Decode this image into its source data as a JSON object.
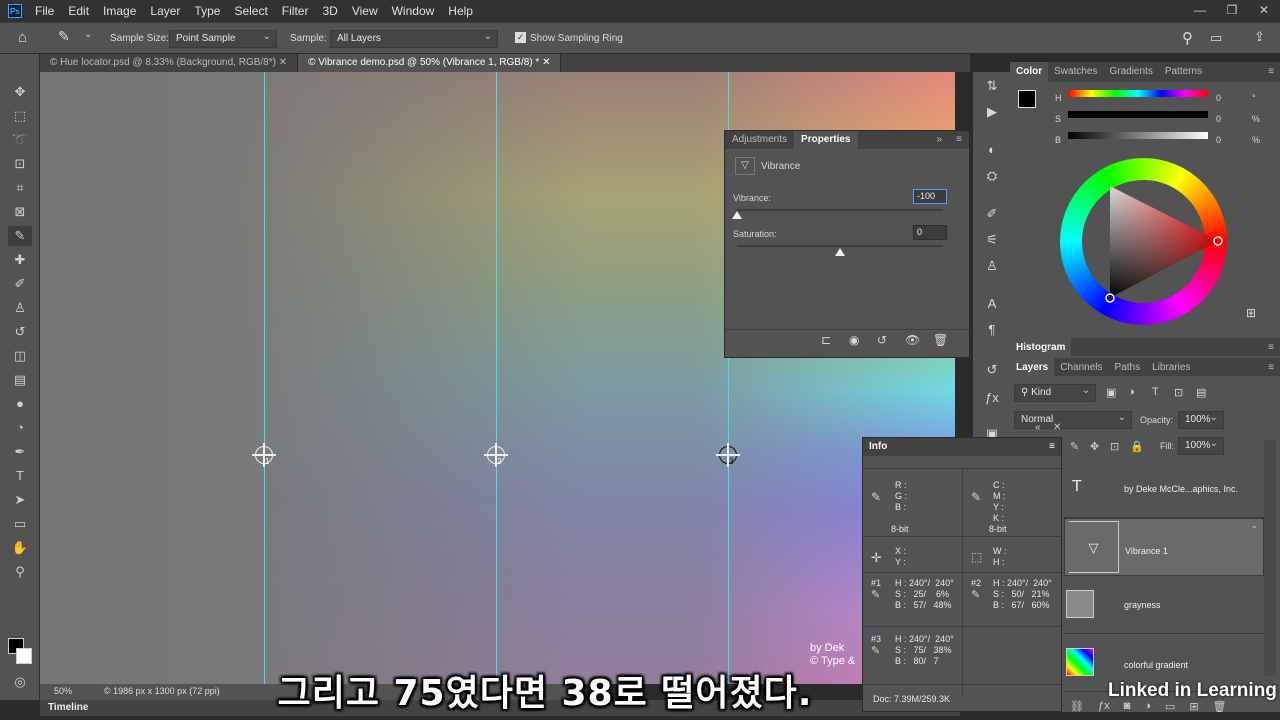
{
  "menu": [
    "File",
    "Edit",
    "Image",
    "Layer",
    "Type",
    "Select",
    "Filter",
    "3D",
    "View",
    "Window",
    "Help"
  ],
  "app_logo": "Ps",
  "options": {
    "sample_size_label": "Sample Size:",
    "sample_size": "Point Sample",
    "sample_label": "Sample:",
    "sample": "All Layers",
    "ring_label": "Show Sampling Ring"
  },
  "doc_tabs": [
    "© Hue locator.psd @ 8.33% (Background, RGB/8*)",
    "© Vibrance demo.psd @ 50% (Vibrance 1, RGB/8) *"
  ],
  "samplers": [
    "1",
    "2",
    "3"
  ],
  "properties": {
    "tabs": [
      "Adjustments",
      "Properties"
    ],
    "title": "Vibrance",
    "vibrance_label": "Vibrance:",
    "vibrance": "-100",
    "saturation_label": "Saturation:",
    "saturation": "0",
    "vibrance_level": 0,
    "saturation_level": 0.5
  },
  "color_panel": {
    "tabs": [
      "Color",
      "Swatches",
      "Gradients",
      "Patterns"
    ],
    "rows": [
      {
        "label": "H",
        "value": "0",
        "unit": "°"
      },
      {
        "label": "S",
        "value": "0",
        "unit": "%"
      },
      {
        "label": "B",
        "value": "0",
        "unit": "%"
      }
    ]
  },
  "histogram_title": "Histogram",
  "layers_panel": {
    "tabs": [
      "Layers",
      "Channels",
      "Paths",
      "Libraries"
    ],
    "kind": "Kind",
    "blend": "Normal",
    "opacity_label": "Opacity:",
    "opacity": "100%",
    "fill_label": "Fill:",
    "fill": "100%",
    "layers": [
      "by Deke McCle...aphics, Inc.",
      "Vibrance 1",
      "grayness",
      "colorful gradient"
    ]
  },
  "info": {
    "title": "Info",
    "rgb": "R :\nG :\nB :",
    "cmyk": "C :\nM :\nY :\nK :",
    "bit1": "8-bit",
    "bit2": "8-bit",
    "xy": "X :\nY :",
    "wh": "W :\nH :",
    "s1": "#1",
    "s1v": "H : 240°/  240°\nS :   25/    6%\nB :   57/   48%",
    "s2": "#2",
    "s2v": "H : 240°/  240°\nS :   50/   21%\nB :   67/   60%",
    "s3": "#3",
    "s3v": "H : 240°/  240°\nS :   75/   38%\nB :   80/   7",
    "doc": "Doc: 7.39M/259.3K"
  },
  "status": {
    "zoom": "50%",
    "size": "© 1986 px x 1300 px (72 ppi)"
  },
  "timeline": "Timeline",
  "canvas_credit": "by Dek\n© Type &",
  "subtitle": "그리고 75였다면 38로 떨어졌다.",
  "watermark": "Linked in Learning"
}
